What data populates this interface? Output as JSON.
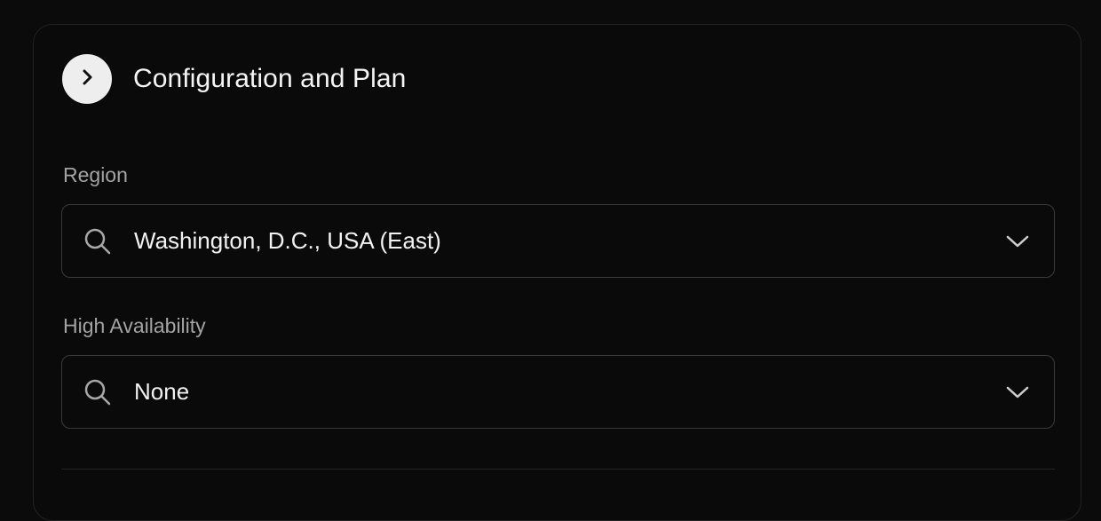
{
  "section": {
    "title": "Configuration and Plan",
    "expand_icon": "chevron-right-icon"
  },
  "region": {
    "label": "Region",
    "value": "Washington, D.C., USA (East)",
    "leading_icon": "search-icon",
    "trailing_icon": "chevron-down-icon"
  },
  "high_availability": {
    "label": "High Availability",
    "value": "None",
    "leading_icon": "search-icon",
    "trailing_icon": "chevron-down-icon"
  },
  "colors": {
    "background": "#0b0b0b",
    "card_border": "#232323",
    "label_text": "#a3a3a3",
    "value_text": "#f2f2f2",
    "badge": "#eeeeee"
  }
}
